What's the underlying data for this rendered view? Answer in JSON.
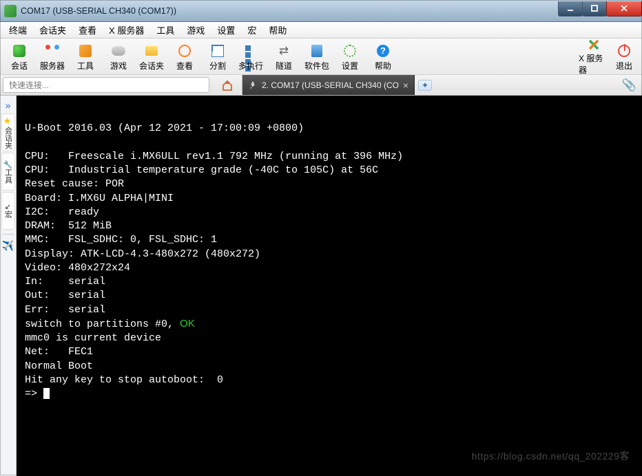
{
  "window": {
    "title": "COM17  (USB-SERIAL CH340 (COM17))"
  },
  "menu": {
    "items": [
      "终端",
      "会话夹",
      "查看",
      "X 服务器",
      "工具",
      "游戏",
      "设置",
      "宏",
      "帮助"
    ]
  },
  "toolbar": {
    "main": [
      {
        "label": "会话",
        "icon": "session-icon"
      },
      {
        "label": "服务器",
        "icon": "servers-icon"
      },
      {
        "label": "工具",
        "icon": "tools-icon"
      },
      {
        "label": "游戏",
        "icon": "games-icon"
      },
      {
        "label": "会话夹",
        "icon": "sessions-folder-icon"
      },
      {
        "label": "查看",
        "icon": "view-icon"
      },
      {
        "label": "分割",
        "icon": "split-icon"
      },
      {
        "label": "多执行",
        "icon": "multiexec-icon"
      },
      {
        "label": "隧道",
        "icon": "tunnel-icon"
      },
      {
        "label": "软件包",
        "icon": "packages-icon"
      },
      {
        "label": "设置",
        "icon": "settings-icon"
      },
      {
        "label": "帮助",
        "icon": "help-icon"
      }
    ],
    "right": [
      {
        "label": "X 服务器",
        "icon": "xserver-icon"
      },
      {
        "label": "退出",
        "icon": "exit-icon"
      }
    ]
  },
  "quick_connect": {
    "placeholder": "快速连接..."
  },
  "tabs": {
    "active": {
      "index": "2.",
      "label": "COM17  (USB-SERIAL CH340 (CO"
    }
  },
  "sidebar": {
    "items": [
      "会话夹",
      "工具",
      "宏"
    ]
  },
  "terminal": {
    "lines": [
      "",
      "U-Boot 2016.03 (Apr 12 2021 - 17:00:09 +0800)",
      "",
      "CPU:   Freescale i.MX6ULL rev1.1 792 MHz (running at 396 MHz)",
      "CPU:   Industrial temperature grade (-40C to 105C) at 56C",
      "Reset cause: POR",
      "Board: I.MX6U ALPHA|MINI",
      "I2C:   ready",
      "DRAM:  512 MiB",
      "MMC:   FSL_SDHC: 0, FSL_SDHC: 1",
      "Display: ATK-LCD-4.3-480x272 (480x272)",
      "Video: 480x272x24",
      "In:    serial",
      "Out:   serial",
      "Err:   serial"
    ],
    "switch_line_prefix": "switch to partitions #0, ",
    "switch_line_ok": "OK",
    "lines_after": [
      "mmc0 is current device",
      "Net:   FEC1",
      "Normal Boot",
      "Hit any key to stop autoboot:  0"
    ],
    "prompt": "=> "
  },
  "watermark": "https://blog.csdn.net/qq_202229客"
}
